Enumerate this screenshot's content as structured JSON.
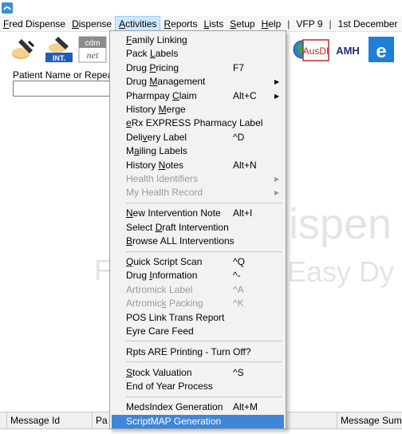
{
  "menubar": {
    "items": [
      {
        "pre": "",
        "u": "F",
        "post": "red Dispense",
        "name": "menu-fred-dispense"
      },
      {
        "pre": "",
        "u": "D",
        "post": "ispense",
        "name": "menu-dispense"
      },
      {
        "pre": "",
        "u": "A",
        "post": "ctivities",
        "name": "menu-activities",
        "active": true
      },
      {
        "pre": "",
        "u": "R",
        "post": "eports",
        "name": "menu-reports"
      },
      {
        "pre": "",
        "u": "L",
        "post": "ists",
        "name": "menu-lists"
      },
      {
        "pre": "",
        "u": "S",
        "post": "etup",
        "name": "menu-setup"
      },
      {
        "pre": "",
        "u": "H",
        "post": "elp",
        "name": "menu-help"
      }
    ],
    "sep1": "|",
    "version": "VFP 9",
    "sep2": "|",
    "date": "1st December"
  },
  "toolbar": {
    "int_label": "INT.",
    "cdm_label": "cdm",
    "net_label": "net",
    "ausdi_label": "AusDI",
    "amh_label": "AMH",
    "e_label": "e"
  },
  "patient": {
    "label": "Patient Name or Repeat"
  },
  "watermark": {
    "line1": "ispen",
    "line2": "Easy Dy",
    "line3": "F"
  },
  "grid": {
    "columns": [
      "Message Id",
      "Pa",
      "Message Summ"
    ]
  },
  "colors": {
    "highlight": "#3f86d9",
    "menu_active": "#cce8ff",
    "disabled": "#9a9a9a"
  },
  "activities_menu": {
    "items": [
      {
        "pre": "",
        "u": "F",
        "post": "amily Linking",
        "shortcut": "",
        "submenu": false,
        "disabled": false,
        "name": "menuitem-family-linking"
      },
      {
        "pre": "Pack ",
        "u": "L",
        "post": "abels",
        "shortcut": "",
        "submenu": false,
        "disabled": false,
        "name": "menuitem-pack-labels"
      },
      {
        "pre": "Drug ",
        "u": "P",
        "post": "ricing",
        "shortcut": "F7",
        "submenu": false,
        "disabled": false,
        "name": "menuitem-drug-pricing"
      },
      {
        "pre": "Drug ",
        "u": "M",
        "post": "anagement",
        "shortcut": "",
        "submenu": true,
        "disabled": false,
        "name": "menuitem-drug-management"
      },
      {
        "pre": "Pharmpay ",
        "u": "C",
        "post": "laim",
        "shortcut": "Alt+C",
        "submenu": true,
        "disabled": false,
        "name": "menuitem-pharmpay-claim"
      },
      {
        "pre": "History ",
        "u": "M",
        "post": "erge",
        "shortcut": "",
        "submenu": false,
        "disabled": false,
        "name": "menuitem-history-merge"
      },
      {
        "pre": "",
        "u": "e",
        "post": "Rx EXPRESS Pharmacy Label",
        "shortcut": "",
        "submenu": false,
        "disabled": false,
        "name": "menuitem-erx-express-label"
      },
      {
        "pre": "Deli",
        "u": "v",
        "post": "ery Label",
        "shortcut": "^D",
        "submenu": false,
        "disabled": false,
        "name": "menuitem-delivery-label"
      },
      {
        "pre": "M",
        "u": "a",
        "post": "iling Labels",
        "shortcut": "",
        "submenu": false,
        "disabled": false,
        "name": "menuitem-mailing-labels"
      },
      {
        "pre": "History ",
        "u": "N",
        "post": "otes",
        "shortcut": "Alt+N",
        "submenu": false,
        "disabled": false,
        "name": "menuitem-history-notes"
      },
      {
        "pre": "Health Identifiers",
        "u": "",
        "post": "",
        "shortcut": "",
        "submenu": true,
        "disabled": true,
        "name": "menuitem-health-identifiers"
      },
      {
        "pre": "My Health Record",
        "u": "",
        "post": "",
        "shortcut": "",
        "submenu": true,
        "disabled": true,
        "name": "menuitem-my-health-record"
      },
      {
        "pre": "",
        "u": "N",
        "post": "ew Intervention Note",
        "shortcut": "Alt+I",
        "submenu": false,
        "disabled": false,
        "name": "menuitem-new-intervention-note"
      },
      {
        "pre": "Select ",
        "u": "D",
        "post": "raft Intervention",
        "shortcut": "",
        "submenu": false,
        "disabled": false,
        "name": "menuitem-select-draft-intervention"
      },
      {
        "pre": "",
        "u": "B",
        "post": "rowse ALL Interventions",
        "shortcut": "",
        "submenu": false,
        "disabled": false,
        "name": "menuitem-browse-interventions"
      },
      {
        "pre": "",
        "u": "Q",
        "post": "uick Script Scan",
        "shortcut": "^Q",
        "submenu": false,
        "disabled": false,
        "name": "menuitem-quick-script-scan"
      },
      {
        "pre": "Drug ",
        "u": "I",
        "post": "nformation",
        "shortcut": "^-",
        "submenu": false,
        "disabled": false,
        "name": "menuitem-drug-information"
      },
      {
        "pre": "Artromick Label",
        "u": "",
        "post": "",
        "shortcut": "^A",
        "submenu": false,
        "disabled": true,
        "name": "menuitem-artromick-label"
      },
      {
        "pre": "Artromic",
        "u": "k",
        "post": " Packing",
        "shortcut": "^K",
        "submenu": false,
        "disabled": true,
        "name": "menuitem-artromick-packing"
      },
      {
        "pre": "POS Link Trans Report",
        "u": "",
        "post": "",
        "shortcut": "",
        "submenu": false,
        "disabled": false,
        "name": "menuitem-pos-link-report"
      },
      {
        "pre": "Eyre Care Feed",
        "u": "",
        "post": "",
        "shortcut": "",
        "submenu": false,
        "disabled": false,
        "name": "menuitem-eyre-care-feed"
      },
      {
        "pre": "Rpts ARE Printing - Turn Off?",
        "u": "",
        "post": "",
        "shortcut": "",
        "submenu": false,
        "disabled": false,
        "name": "menuitem-rpts-printing"
      },
      {
        "pre": "",
        "u": "S",
        "post": "tock Valuation",
        "shortcut": "^S",
        "submenu": false,
        "disabled": false,
        "name": "menuitem-stock-valuation"
      },
      {
        "pre": "End of Year Process",
        "u": "",
        "post": "",
        "shortcut": "",
        "submenu": false,
        "disabled": false,
        "name": "menuitem-end-of-year"
      },
      {
        "pre": "MedsIndex Generation",
        "u": "",
        "post": "",
        "shortcut": "Alt+M",
        "submenu": false,
        "disabled": false,
        "name": "menuitem-medsindex-generation"
      },
      {
        "pre": "ScriptMAP Generation",
        "u": "",
        "post": "",
        "shortcut": "",
        "submenu": false,
        "disabled": false,
        "highlight": true,
        "name": "menuitem-scriptmap-generation"
      }
    ]
  }
}
